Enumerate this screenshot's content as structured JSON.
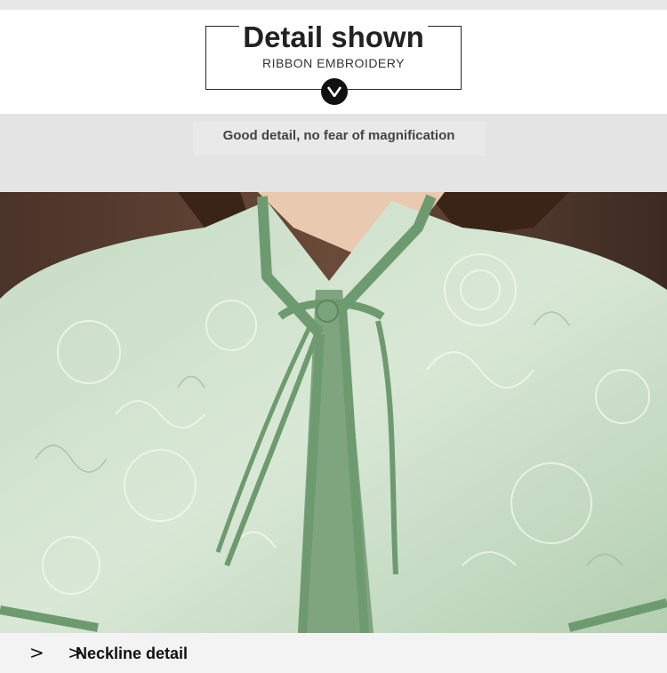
{
  "header": {
    "title": "Detail shown",
    "subtitle": "RIBBON EMBROIDERY"
  },
  "tagline": "Good detail, no fear of magnification",
  "footer": {
    "arrows": "> >",
    "label": "Neckline detail"
  },
  "colors": {
    "fabric": "#b8d1b6",
    "trim": "#6e9a70",
    "background_gray": "#e4e4e4"
  },
  "icons": [
    "chevron-down-icon",
    "double-chevron-right-icon"
  ]
}
